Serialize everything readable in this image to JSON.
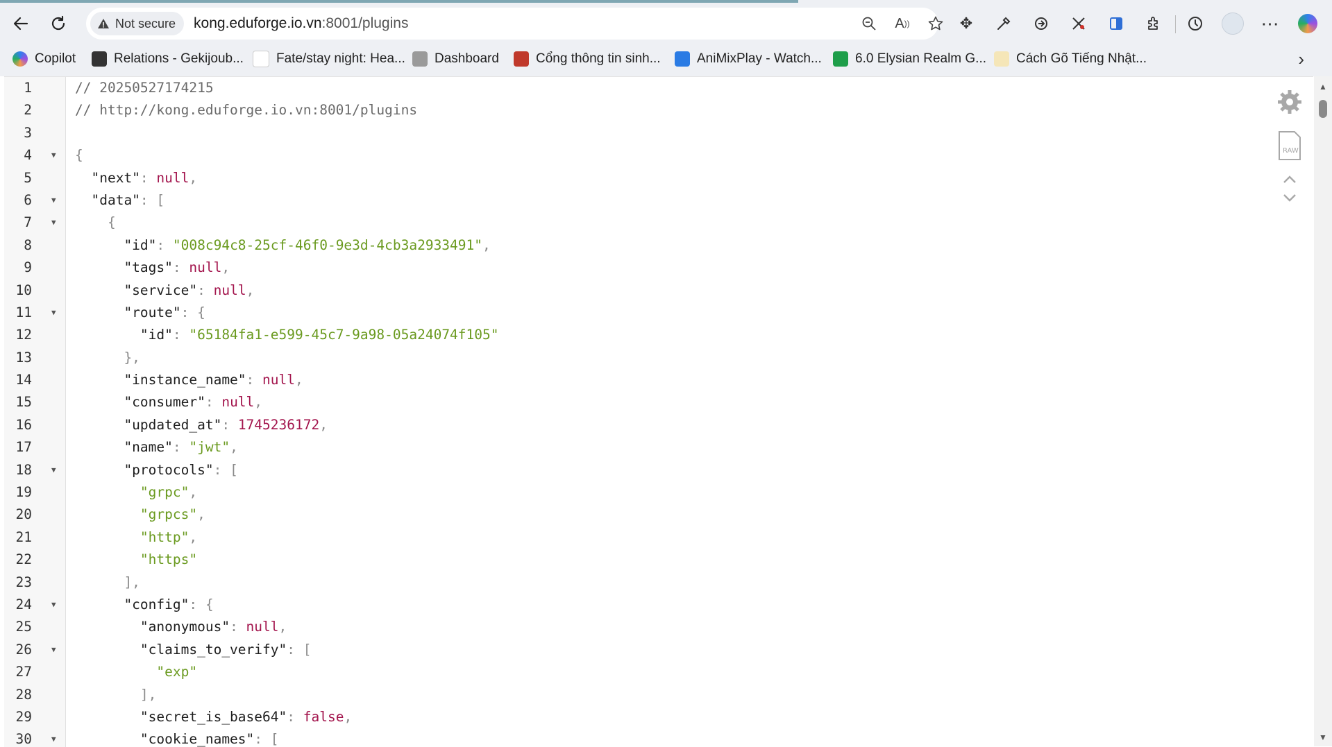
{
  "browser": {
    "security_label": "Not secure",
    "url_host": "kong.eduforge.io.vn",
    "url_path": ":8001/plugins"
  },
  "bookmarks": [
    {
      "label": "Copilot",
      "color": "#4e8ef7"
    },
    {
      "label": "Relations - Gekijoub...",
      "color": "#333333"
    },
    {
      "label": "Fate/stay night: Hea...",
      "color": "#ffffff"
    },
    {
      "label": "Dashboard",
      "color": "#888888"
    },
    {
      "label": "Cổng thông tin sinh...",
      "color": "#c0392b"
    },
    {
      "label": "AniMixPlay - Watch...",
      "color": "#2a7be4"
    },
    {
      "label": "6.0 Elysian Realm G...",
      "color": "#1e9e4a"
    },
    {
      "label": "Cách Gõ Tiếng Nhật...",
      "color": "#d4a017"
    }
  ],
  "json_viewer": {
    "lines": [
      {
        "n": "1",
        "fold": false,
        "segs": [
          [
            "c-comment",
            "// 20250527174215"
          ]
        ]
      },
      {
        "n": "2",
        "fold": false,
        "segs": [
          [
            "c-comment",
            "// http://kong.eduforge.io.vn:8001/plugins"
          ]
        ]
      },
      {
        "n": "3",
        "fold": false,
        "segs": []
      },
      {
        "n": "4",
        "fold": true,
        "segs": [
          [
            "c-punc",
            "{"
          ]
        ]
      },
      {
        "n": "5",
        "fold": false,
        "segs": [
          [
            "c-key",
            "  \"next\""
          ],
          [
            "c-punc",
            ": "
          ],
          [
            "c-null",
            "null"
          ],
          [
            "c-punc",
            ","
          ]
        ]
      },
      {
        "n": "6",
        "fold": true,
        "segs": [
          [
            "c-key",
            "  \"data\""
          ],
          [
            "c-punc",
            ": ["
          ]
        ]
      },
      {
        "n": "7",
        "fold": true,
        "segs": [
          [
            "c-punc",
            "    {"
          ]
        ]
      },
      {
        "n": "8",
        "fold": false,
        "segs": [
          [
            "c-key",
            "      \"id\""
          ],
          [
            "c-punc",
            ": "
          ],
          [
            "c-str",
            "\"008c94c8-25cf-46f0-9e3d-4cb3a2933491\""
          ],
          [
            "c-punc",
            ","
          ]
        ]
      },
      {
        "n": "9",
        "fold": false,
        "segs": [
          [
            "c-key",
            "      \"tags\""
          ],
          [
            "c-punc",
            ": "
          ],
          [
            "c-null",
            "null"
          ],
          [
            "c-punc",
            ","
          ]
        ]
      },
      {
        "n": "10",
        "fold": false,
        "segs": [
          [
            "c-key",
            "      \"service\""
          ],
          [
            "c-punc",
            ": "
          ],
          [
            "c-null",
            "null"
          ],
          [
            "c-punc",
            ","
          ]
        ]
      },
      {
        "n": "11",
        "fold": true,
        "segs": [
          [
            "c-key",
            "      \"route\""
          ],
          [
            "c-punc",
            ": {"
          ]
        ]
      },
      {
        "n": "12",
        "fold": false,
        "segs": [
          [
            "c-key",
            "        \"id\""
          ],
          [
            "c-punc",
            ": "
          ],
          [
            "c-str",
            "\"65184fa1-e599-45c7-9a98-05a24074f105\""
          ]
        ]
      },
      {
        "n": "13",
        "fold": false,
        "segs": [
          [
            "c-punc",
            "      },"
          ]
        ]
      },
      {
        "n": "14",
        "fold": false,
        "segs": [
          [
            "c-key",
            "      \"instance_name\""
          ],
          [
            "c-punc",
            ": "
          ],
          [
            "c-null",
            "null"
          ],
          [
            "c-punc",
            ","
          ]
        ]
      },
      {
        "n": "15",
        "fold": false,
        "segs": [
          [
            "c-key",
            "      \"consumer\""
          ],
          [
            "c-punc",
            ": "
          ],
          [
            "c-null",
            "null"
          ],
          [
            "c-punc",
            ","
          ]
        ]
      },
      {
        "n": "16",
        "fold": false,
        "segs": [
          [
            "c-key",
            "      \"updated_at\""
          ],
          [
            "c-punc",
            ": "
          ],
          [
            "c-num",
            "1745236172"
          ],
          [
            "c-punc",
            ","
          ]
        ]
      },
      {
        "n": "17",
        "fold": false,
        "segs": [
          [
            "c-key",
            "      \"name\""
          ],
          [
            "c-punc",
            ": "
          ],
          [
            "c-str",
            "\"jwt\""
          ],
          [
            "c-punc",
            ","
          ]
        ]
      },
      {
        "n": "18",
        "fold": true,
        "segs": [
          [
            "c-key",
            "      \"protocols\""
          ],
          [
            "c-punc",
            ": ["
          ]
        ]
      },
      {
        "n": "19",
        "fold": false,
        "segs": [
          [
            "c-str",
            "        \"grpc\""
          ],
          [
            "c-punc",
            ","
          ]
        ]
      },
      {
        "n": "20",
        "fold": false,
        "segs": [
          [
            "c-str",
            "        \"grpcs\""
          ],
          [
            "c-punc",
            ","
          ]
        ]
      },
      {
        "n": "21",
        "fold": false,
        "segs": [
          [
            "c-str",
            "        \"http\""
          ],
          [
            "c-punc",
            ","
          ]
        ]
      },
      {
        "n": "22",
        "fold": false,
        "segs": [
          [
            "c-str",
            "        \"https\""
          ]
        ]
      },
      {
        "n": "23",
        "fold": false,
        "segs": [
          [
            "c-punc",
            "      ],"
          ]
        ]
      },
      {
        "n": "24",
        "fold": true,
        "segs": [
          [
            "c-key",
            "      \"config\""
          ],
          [
            "c-punc",
            ": {"
          ]
        ]
      },
      {
        "n": "25",
        "fold": false,
        "segs": [
          [
            "c-key",
            "        \"anonymous\""
          ],
          [
            "c-punc",
            ": "
          ],
          [
            "c-null",
            "null"
          ],
          [
            "c-punc",
            ","
          ]
        ]
      },
      {
        "n": "26",
        "fold": true,
        "segs": [
          [
            "c-key",
            "        \"claims_to_verify\""
          ],
          [
            "c-punc",
            ": ["
          ]
        ]
      },
      {
        "n": "27",
        "fold": false,
        "segs": [
          [
            "c-str",
            "          \"exp\""
          ]
        ]
      },
      {
        "n": "28",
        "fold": false,
        "segs": [
          [
            "c-punc",
            "        ],"
          ]
        ]
      },
      {
        "n": "29",
        "fold": false,
        "segs": [
          [
            "c-key",
            "        \"secret_is_base64\""
          ],
          [
            "c-punc",
            ": "
          ],
          [
            "c-null",
            "false"
          ],
          [
            "c-punc",
            ","
          ]
        ]
      },
      {
        "n": "30",
        "fold": true,
        "segs": [
          [
            "c-key",
            "        \"cookie_names\""
          ],
          [
            "c-punc",
            ": ["
          ]
        ]
      }
    ]
  }
}
